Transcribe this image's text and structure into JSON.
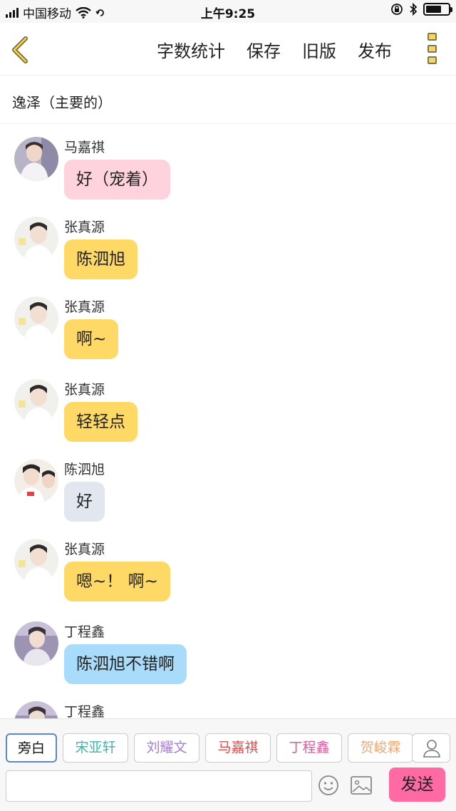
{
  "status_bar": {
    "carrier": "中国移动",
    "time": "上午9:25"
  },
  "nav": {
    "actions": [
      "字数统计",
      "保存",
      "旧版",
      "发布"
    ]
  },
  "title": "逸泽（主要的）",
  "messages": [
    {
      "sender": "马嘉祺",
      "text": "好（宠着）",
      "bubble_color": "#ffd3dd",
      "avatar": "avatar-ma"
    },
    {
      "sender": "张真源",
      "text": "陈泗旭",
      "bubble_color": "#ffd966",
      "avatar": "avatar-zhang"
    },
    {
      "sender": "张真源",
      "text": "啊~",
      "bubble_color": "#ffd966",
      "avatar": "avatar-zhang"
    },
    {
      "sender": "张真源",
      "text": "轻轻点",
      "bubble_color": "#ffd966",
      "avatar": "avatar-zhang"
    },
    {
      "sender": "陈泗旭",
      "text": "好",
      "bubble_color": "#e2e7ef",
      "avatar": "avatar-chen"
    },
    {
      "sender": "张真源",
      "text": "嗯~！ 啊~",
      "bubble_color": "#ffd966",
      "avatar": "avatar-zhang"
    },
    {
      "sender": "丁程鑫",
      "text": "陈泗旭不错啊",
      "bubble_color": "#a9dcfa",
      "avatar": "avatar-ding"
    },
    {
      "sender": "丁程鑫",
      "text": "",
      "bubble_color": "#a9dcfa",
      "avatar": "avatar-ding"
    }
  ],
  "characters": [
    {
      "label": "旁白",
      "color": "#111111"
    },
    {
      "label": "宋亚轩",
      "color": "#3fb7a8"
    },
    {
      "label": "刘耀文",
      "color": "#a47fd6"
    },
    {
      "label": "马嘉祺",
      "color": "#e04a4a"
    },
    {
      "label": "丁程鑫",
      "color": "#e0579b"
    },
    {
      "label": "贺峻霖",
      "color": "#f0a878"
    }
  ],
  "composer": {
    "input_placeholder": "",
    "send_label": "发送"
  }
}
